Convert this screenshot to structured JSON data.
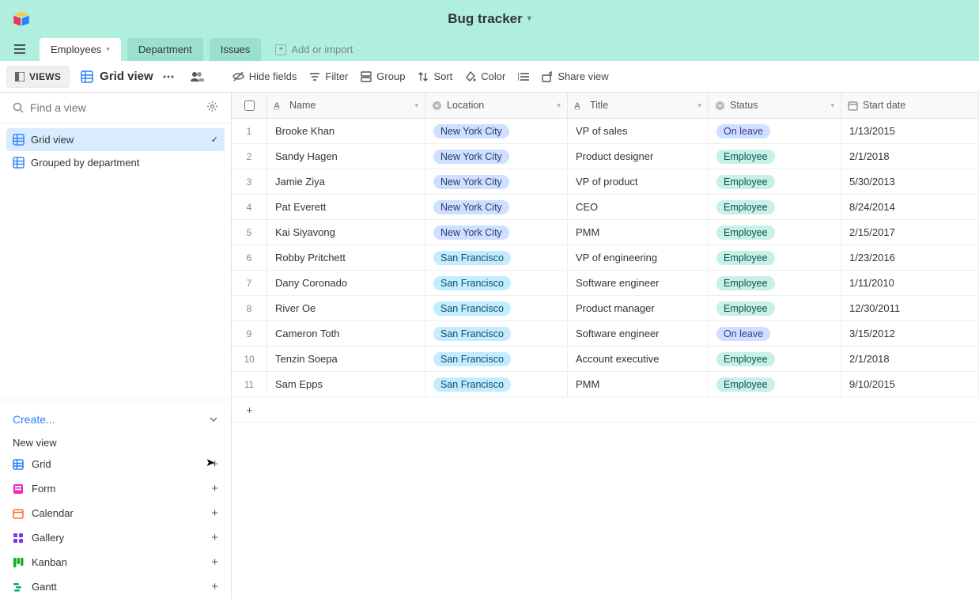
{
  "base_name": "Bug tracker",
  "sidebar_toggle_label": "VIEWS",
  "tabs": {
    "active": "Employees",
    "list": [
      "Employees",
      "Department",
      "Issues"
    ],
    "add_label": "Add or import"
  },
  "view_title": "Grid view",
  "toolbar": {
    "hide": "Hide fields",
    "filter": "Filter",
    "group": "Group",
    "sort": "Sort",
    "color": "Color",
    "share": "Share view"
  },
  "find_view_placeholder": "Find a view",
  "views": [
    {
      "label": "Grid view",
      "selected": true
    },
    {
      "label": "Grouped by department",
      "selected": false
    }
  ],
  "create_label": "Create...",
  "new_view_label": "New view",
  "viewTypes": [
    {
      "label": "Grid",
      "icon": "grid",
      "color": "#2d7ff9"
    },
    {
      "label": "Form",
      "icon": "form",
      "color": "#e929ba"
    },
    {
      "label": "Calendar",
      "icon": "calendar",
      "color": "#ff6f2c"
    },
    {
      "label": "Gallery",
      "icon": "gallery",
      "color": "#7c39ed"
    },
    {
      "label": "Kanban",
      "icon": "kanban",
      "color": "#11af22"
    },
    {
      "label": "Gantt",
      "icon": "gantt",
      "color": "#0aa37b"
    }
  ],
  "columns": {
    "name": "Name",
    "location": "Location",
    "title": "Title",
    "status": "Status",
    "start": "Start date"
  },
  "rows": [
    {
      "n": 1,
      "name": "Brooke Khan",
      "loc": "New York City",
      "locCls": "ny",
      "title": "VP of sales",
      "status": "On leave",
      "statCls": "leave",
      "date": "1/13/2015"
    },
    {
      "n": 2,
      "name": "Sandy Hagen",
      "loc": "New York City",
      "locCls": "ny",
      "title": "Product designer",
      "status": "Employee",
      "statCls": "emp",
      "date": "2/1/2018"
    },
    {
      "n": 3,
      "name": "Jamie Ziya",
      "loc": "New York City",
      "locCls": "ny",
      "title": "VP of product",
      "status": "Employee",
      "statCls": "emp",
      "date": "5/30/2013"
    },
    {
      "n": 4,
      "name": "Pat Everett",
      "loc": "New York City",
      "locCls": "ny",
      "title": "CEO",
      "status": "Employee",
      "statCls": "emp",
      "date": "8/24/2014"
    },
    {
      "n": 5,
      "name": "Kai Siyavong",
      "loc": "New York City",
      "locCls": "ny",
      "title": "PMM",
      "status": "Employee",
      "statCls": "emp",
      "date": "2/15/2017"
    },
    {
      "n": 6,
      "name": "Robby Pritchett",
      "loc": "San Francisco",
      "locCls": "sf",
      "title": "VP of engineering",
      "status": "Employee",
      "statCls": "emp",
      "date": "1/23/2016"
    },
    {
      "n": 7,
      "name": "Dany Coronado",
      "loc": "San Francisco",
      "locCls": "sf",
      "title": "Software engineer",
      "status": "Employee",
      "statCls": "emp",
      "date": "1/11/2010"
    },
    {
      "n": 8,
      "name": "River Oe",
      "loc": "San Francisco",
      "locCls": "sf",
      "title": "Product manager",
      "status": "Employee",
      "statCls": "emp",
      "date": "12/30/2011"
    },
    {
      "n": 9,
      "name": "Cameron Toth",
      "loc": "San Francisco",
      "locCls": "sf",
      "title": "Software engineer",
      "status": "On leave",
      "statCls": "leave",
      "date": "3/15/2012"
    },
    {
      "n": 10,
      "name": "Tenzin Soepa",
      "loc": "San Francisco",
      "locCls": "sf",
      "title": "Account executive",
      "status": "Employee",
      "statCls": "emp",
      "date": "2/1/2018"
    },
    {
      "n": 11,
      "name": "Sam Epps",
      "loc": "San Francisco",
      "locCls": "sf",
      "title": "PMM",
      "status": "Employee",
      "statCls": "emp",
      "date": "9/10/2015"
    }
  ]
}
